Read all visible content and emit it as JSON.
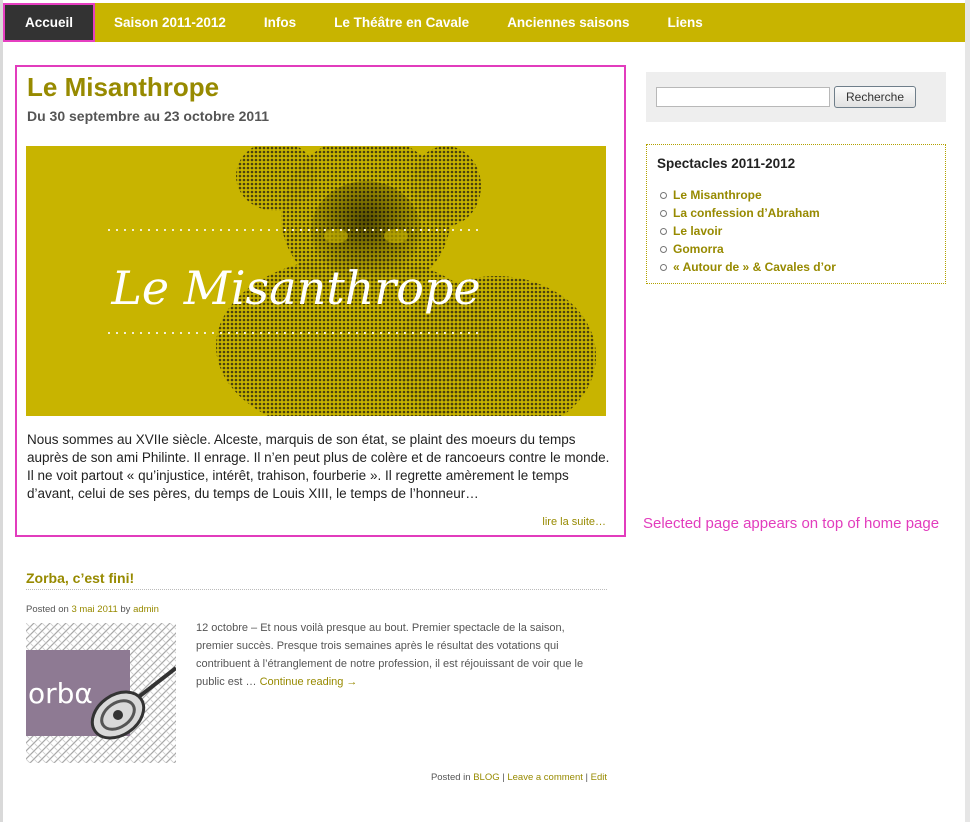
{
  "nav": {
    "items": [
      {
        "label": "Accueil"
      },
      {
        "label": "Saison 2011-2012"
      },
      {
        "label": "Infos"
      },
      {
        "label": "Le Théâtre en Cavale"
      },
      {
        "label": "Anciennes saisons"
      },
      {
        "label": "Liens"
      }
    ]
  },
  "featured": {
    "title": "Le Misanthrope",
    "subtitle": "Du 30 septembre au 23 octobre 2011",
    "image_text": "Le Misanthrope",
    "excerpt": "Nous sommes au XVIIe siècle. Alceste, marquis de son état, se plaint des moeurs du temps auprès de son ami Philinte. Il enrage. Il n’en peut plus de colère et de rancoeurs contre le monde. Il ne voit partout « qu’injustice, intérêt, trahison, fourberie ». Il regrette amèrement le temps d’avant, celui de ses pères, du temps de Louis XIII, le temps de l’honneur…",
    "more": "lire la suite…"
  },
  "annotation": "Selected page appears on top of home page",
  "search": {
    "value": "",
    "button": "Recherche"
  },
  "widget": {
    "title": "Spectacles 2011-2012",
    "items": [
      {
        "label": "Le Misanthrope"
      },
      {
        "label": "La confession d’Abraham"
      },
      {
        "label": "Le lavoir"
      },
      {
        "label": "Gomorra"
      },
      {
        "label": "« Autour de » & Cavales d’or"
      }
    ]
  },
  "post": {
    "title": "Zorba, c’est fini!",
    "meta_prefix": "Posted on",
    "date": "3 mai 2011",
    "by": "by",
    "author": "admin",
    "thumb_text": "orbα",
    "body": "12 octobre – Et nous voilà presque au bout. Premier spectacle de la saison, premier succès. Presque trois semaines après le résultat des votations qui contribuent à l’étranglement de notre profession, il est réjouissant de voir que le public est … ",
    "continue": "Continue reading →",
    "posted_in": "Posted in",
    "category": "BLOG",
    "sep1": " | ",
    "comment": "Leave a comment",
    "sep2": " | ",
    "edit": "Edit"
  },
  "colors": {
    "accent": "#c8b400",
    "link": "#978a00",
    "highlight": "#e23cbd",
    "nav_active": "#333333"
  }
}
